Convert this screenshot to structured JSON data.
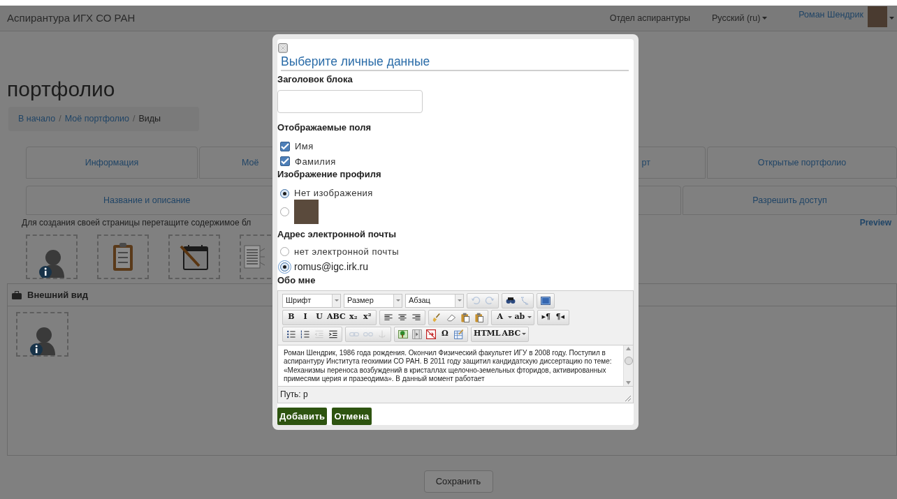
{
  "header_bar": {
    "site_title": "Аспирантура ИГХ СО РАН",
    "links": [
      "Отдел аспирантуры"
    ],
    "language": "Русский (ru)",
    "user_name": "Роман Шендрик"
  },
  "page": {
    "title": "портфолио",
    "breadcrumb_separator": "/",
    "breadcrumbs": [
      {
        "label": "В начало",
        "current": false
      },
      {
        "label": "Моё портфолио",
        "current": false
      },
      {
        "label": "Виды",
        "current": true
      }
    ],
    "tabs_row_1": [
      {
        "label": "Информация",
        "selected": false
      },
      {
        "label": "Моё",
        "selected": false
      },
      {
        "label": "рт",
        "selected": false
      },
      {
        "label": "Открытые портфолио",
        "selected": false
      }
    ],
    "tabs_row_2": [
      {
        "label": "Название и описание",
        "selected": false
      },
      {
        "label": "Разрешить доступ",
        "selected": false
      }
    ],
    "instructions": "Для создания своей страницы перетащите содержимое бл",
    "preview_link": "Preview",
    "section": {
      "title": "Внешний вид"
    },
    "save_button": "Сохранить"
  },
  "dialog": {
    "title": "Выберите личные данные",
    "block_title": {
      "label": "Заголовок блока"
    },
    "displayed_fields": {
      "label": "Отображаемые поля",
      "options": [
        {
          "label": "Имя",
          "checked": true
        },
        {
          "label": "Фамилия",
          "checked": true
        }
      ]
    },
    "profile_image": {
      "label": "Изображение профиля",
      "options": [
        {
          "kind": "text",
          "label": "Нет изображения",
          "selected": true
        },
        {
          "kind": "image",
          "selected": false
        }
      ]
    },
    "email": {
      "label": "Адрес электронной почты",
      "options": [
        {
          "label": "нет электронной почты",
          "selected": false
        },
        {
          "label": "romus@igc.irk.ru",
          "selected": true
        }
      ]
    },
    "about": {
      "label": "Обо мне",
      "selects": [
        "Шрифт",
        "Размер",
        "Абзац"
      ],
      "toolbar_rows": [
        [
          [
            {
              "kind": "undo",
              "disabled": true
            },
            {
              "kind": "redo",
              "disabled": true
            }
          ],
          [
            {
              "kind": "find",
              "disabled": false
            },
            {
              "kind": "replace",
              "disabled": false
            }
          ],
          [
            {
              "kind": "fullscreen",
              "disabled": false
            }
          ]
        ],
        [
          [
            {
              "kind": "text",
              "label": "B",
              "disabled": false
            },
            {
              "kind": "text",
              "label": "I",
              "disabled": false
            },
            {
              "kind": "text",
              "label": "U",
              "disabled": false
            },
            {
              "kind": "text",
              "label": "ABC",
              "disabled": false
            },
            {
              "kind": "text",
              "label": "x₂",
              "disabled": false
            },
            {
              "kind": "text",
              "label": "x²",
              "disabled": false
            }
          ],
          [
            {
              "kind": "align-left",
              "disabled": false
            },
            {
              "kind": "align-center",
              "disabled": false
            },
            {
              "kind": "align-right",
              "disabled": false
            }
          ],
          [
            {
              "kind": "brush",
              "disabled": false
            },
            {
              "kind": "eraser",
              "disabled": false
            },
            {
              "kind": "paste",
              "disabled": false
            },
            {
              "kind": "paste",
              "disabled": false
            }
          ],
          [
            {
              "kind": "text",
              "label": "A",
              "disabled": false
            },
            {
              "kind": "dropdown",
              "disabled": false
            },
            {
              "kind": "text",
              "label": "ab",
              "disabled": false
            },
            {
              "kind": "dropdown",
              "disabled": false
            }
          ],
          [
            {
              "kind": "text",
              "label": "▸¶",
              "disabled": false
            },
            {
              "kind": "text",
              "label": "¶◂",
              "disabled": false
            }
          ]
        ],
        [
          [
            {
              "kind": "bullet-list",
              "disabled": false
            },
            {
              "kind": "numbered-list",
              "disabled": false
            },
            {
              "kind": "outdent",
              "disabled": true
            },
            {
              "kind": "indent",
              "disabled": false
            }
          ],
          [
            {
              "kind": "link",
              "disabled": true
            },
            {
              "kind": "unlink",
              "disabled": true
            },
            {
              "kind": "anchor",
              "disabled": true
            }
          ],
          [
            {
              "kind": "image",
              "disabled": false
            },
            {
              "kind": "media",
              "disabled": false
            },
            {
              "kind": "pagebreak",
              "disabled": false
            },
            {
              "kind": "text",
              "label": "Ω",
              "disabled": false
            },
            {
              "kind": "edit",
              "disabled": false
            }
          ],
          [
            {
              "kind": "text",
              "label": "HTML",
              "disabled": false
            },
            {
              "kind": "text",
              "label": "ABC",
              "disabled": false
            },
            {
              "kind": "dropdown",
              "disabled": false
            }
          ]
        ]
      ],
      "content": "Роман Шендрик, 1986 года рождения. Окончил Физический факультет ИГУ в 2008 году. Поступил в аспирантуру Института геохимии СО РАН. В 2011 году защитил кандидатскую диссертацию по теме: «Механизмы переноса возбуждений в кристаллах щелочно-земельных фторидов, активированных примесями церия и празеодима». В данный момент работает",
      "path": "Путь: p"
    },
    "buttons": [
      "Добавить",
      "Отмена"
    ]
  }
}
